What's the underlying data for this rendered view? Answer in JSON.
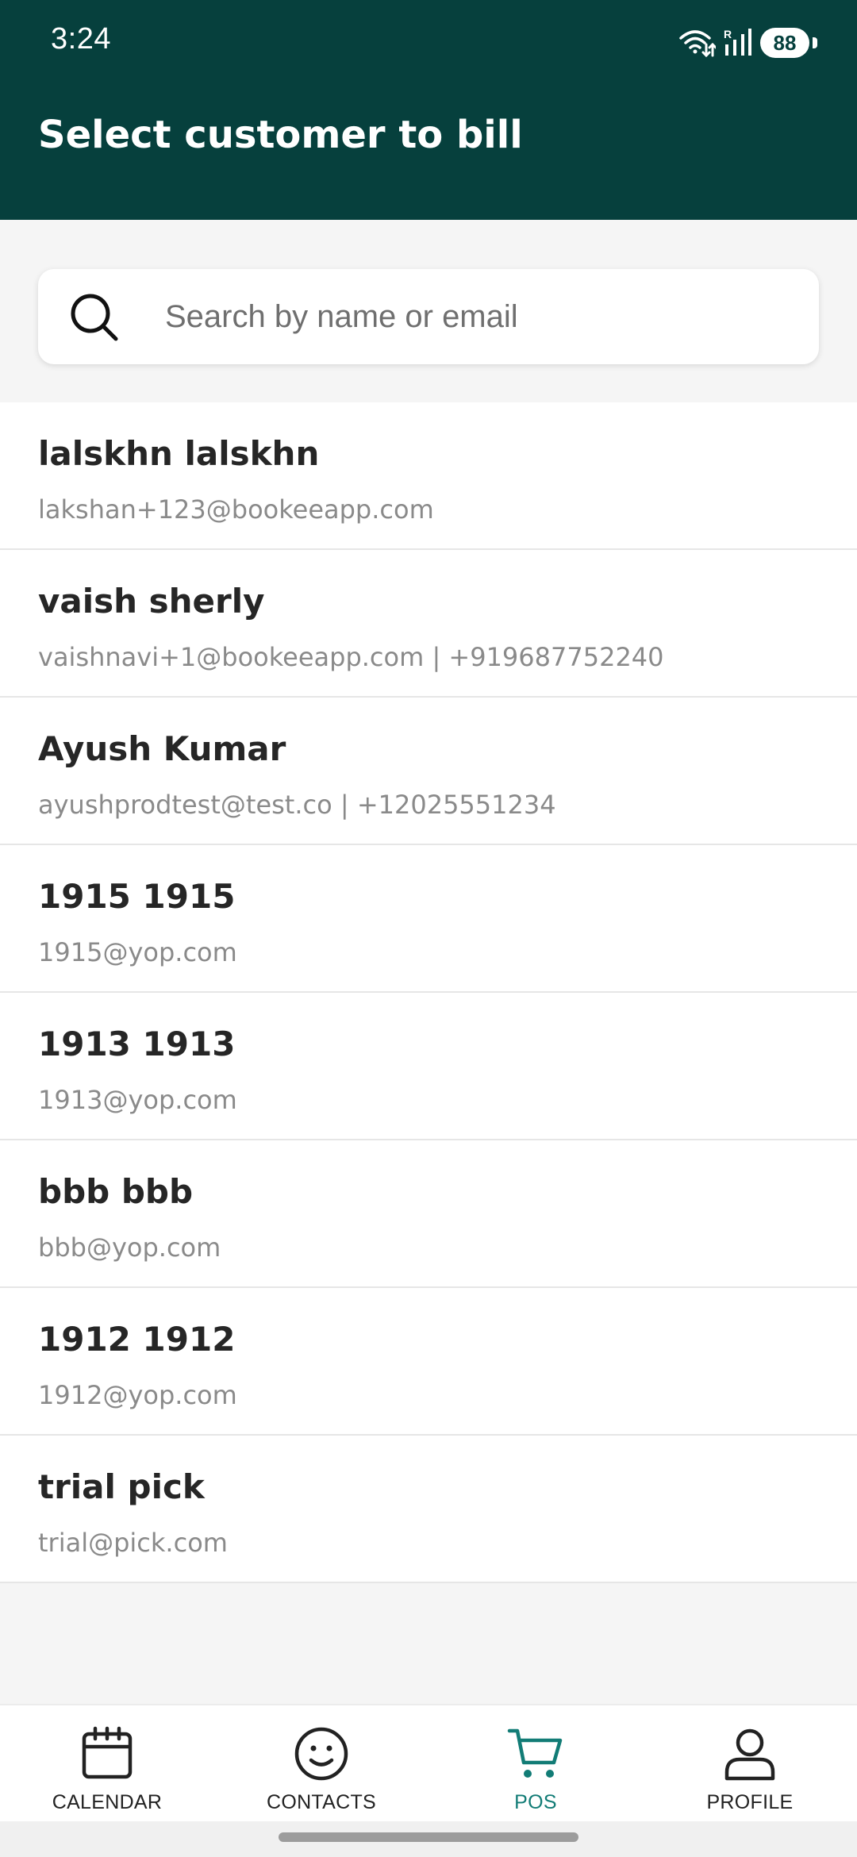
{
  "status_bar": {
    "time": "3:24",
    "battery": "88",
    "icons": [
      "wifi-data-icon",
      "signal-icon",
      "battery-icon"
    ]
  },
  "header": {
    "title": "Select customer to bill",
    "background_color": "#06403d"
  },
  "search": {
    "value": "",
    "placeholder": "Search by name or email",
    "icon": "search-icon"
  },
  "customers": [
    {
      "name": "lalskhn lalskhn",
      "detail": "lakshan+123@bookeeapp.com"
    },
    {
      "name": "vaish sherly",
      "detail": "vaishnavi+1@bookeeapp.com | +919687752240"
    },
    {
      "name": "Ayush Kumar",
      "detail": "ayushprodtest@test.co | +12025551234"
    },
    {
      "name": "1915 1915",
      "detail": "1915@yop.com"
    },
    {
      "name": "1913 1913",
      "detail": "1913@yop.com"
    },
    {
      "name": "bbb bbb",
      "detail": "bbb@yop.com"
    },
    {
      "name": "1912 1912",
      "detail": "1912@yop.com"
    },
    {
      "name": "trial pick",
      "detail": "trial@pick.com"
    }
  ],
  "bottom_nav": {
    "items": [
      {
        "label": "CALENDAR",
        "icon": "calendar-icon",
        "active": false
      },
      {
        "label": "CONTACTS",
        "icon": "smiley-icon",
        "active": false
      },
      {
        "label": "POS",
        "icon": "cart-icon",
        "active": true
      },
      {
        "label": "PROFILE",
        "icon": "user-icon",
        "active": false
      }
    ],
    "active_color": "#127c76"
  }
}
